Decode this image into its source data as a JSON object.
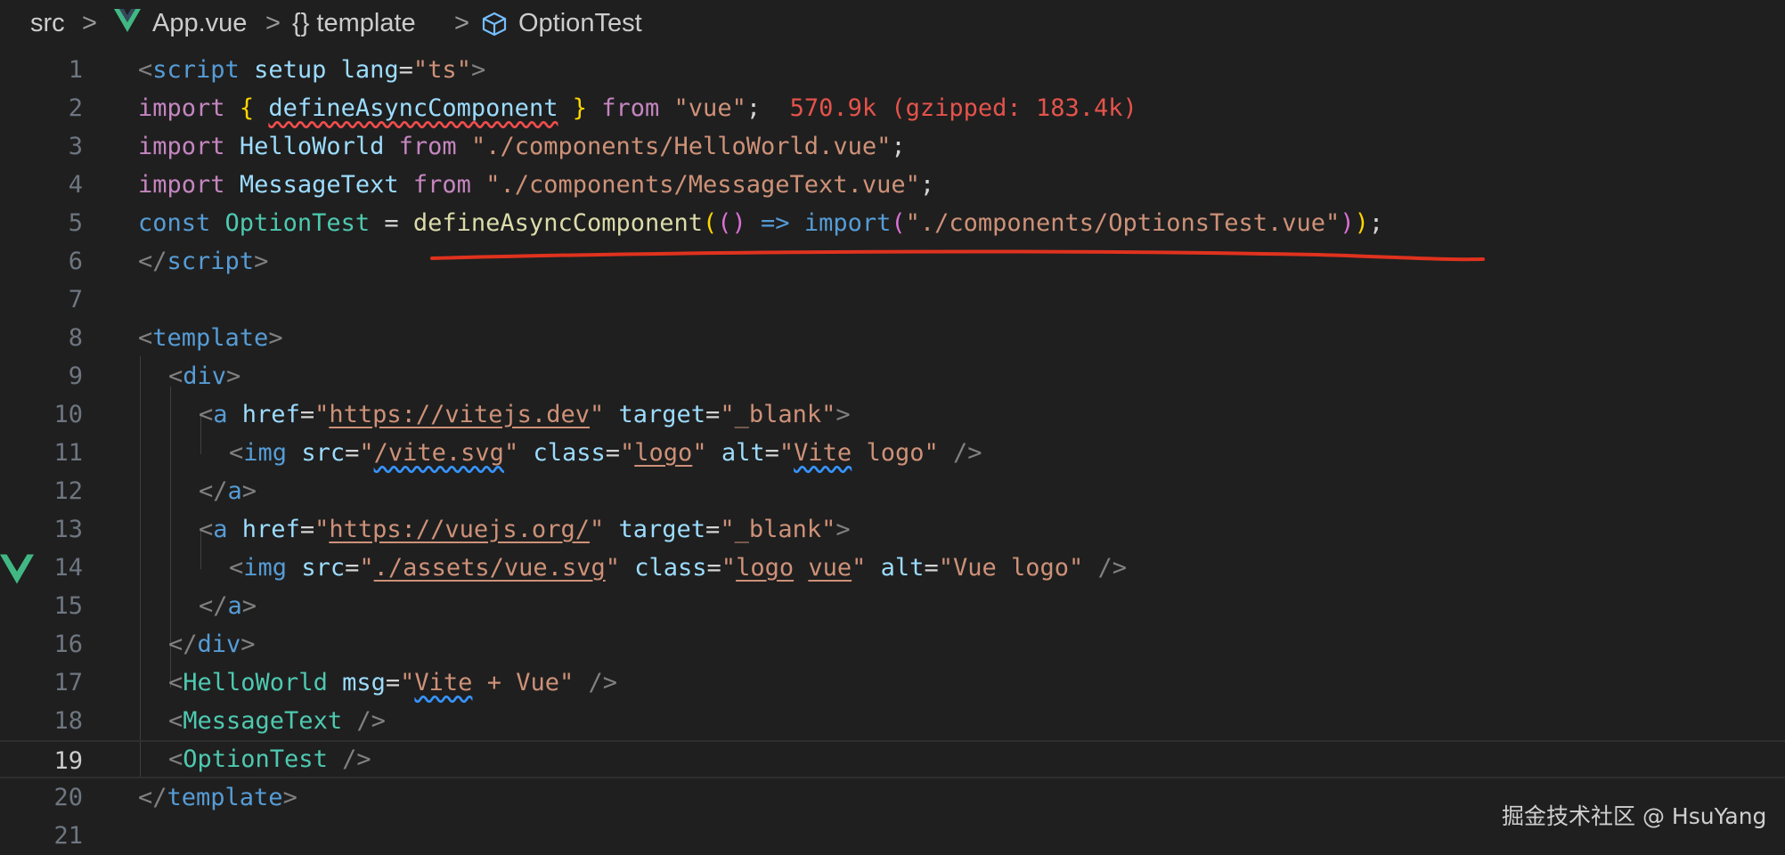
{
  "breadcrumb": {
    "items": [
      "src",
      "App.vue",
      "{} template",
      "OptionTest"
    ],
    "separator": ">"
  },
  "editor": {
    "current_line": 19,
    "line_numbers": [
      "1",
      "2",
      "3",
      "4",
      "5",
      "6",
      "7",
      "8",
      "9",
      "10",
      "11",
      "12",
      "13",
      "14",
      "15",
      "16",
      "17",
      "18",
      "19",
      "20",
      "21"
    ],
    "lines": {
      "l1": [
        "<",
        "script",
        " ",
        "setup",
        " ",
        "lang",
        "=",
        "\"ts\"",
        ">"
      ],
      "l2": [
        "import",
        " ",
        "{",
        " ",
        "defineAsyncComponent",
        " ",
        "}",
        " ",
        "from",
        " ",
        "\"vue\"",
        ";",
        "  570.9k (gzipped: 183.4k)"
      ],
      "l3": [
        "import",
        " ",
        "HelloWorld",
        " ",
        "from",
        " ",
        "\"./components/HelloWorld.vue\"",
        ";"
      ],
      "l4": [
        "import",
        " ",
        "MessageText",
        " ",
        "from",
        " ",
        "\"./components/MessageText.vue\"",
        ";"
      ],
      "l5": [
        "const",
        " ",
        "OptionTest",
        " = ",
        "defineAsyncComponent",
        "(",
        "()",
        " ",
        "=>",
        " ",
        "import",
        "(",
        "\"./components/OptionsTest.vue\"",
        ")",
        ")",
        ";"
      ],
      "l6": [
        "</",
        "script",
        ">"
      ],
      "l8": [
        "<",
        "template",
        ">"
      ],
      "l9": [
        "<",
        "div",
        ">"
      ],
      "l10": [
        "<",
        "a",
        " ",
        "href",
        "=",
        "\"",
        "https://vitejs.dev",
        "\"",
        " ",
        "target",
        "=",
        "\"_blank\"",
        ">"
      ],
      "l11": [
        "<",
        "img",
        " ",
        "src",
        "=",
        "\"",
        "/vite.svg",
        "\"",
        " ",
        "class",
        "=",
        "\"",
        "logo",
        "\"",
        " ",
        "alt",
        "=",
        "\"",
        "Vite",
        " logo\"",
        " />"
      ],
      "l12": [
        "</",
        "a",
        ">"
      ],
      "l13": [
        "<",
        "a",
        " ",
        "href",
        "=",
        "\"",
        "https://vuejs.org/",
        "\"",
        " ",
        "target",
        "=",
        "\"_blank\"",
        ">"
      ],
      "l14": [
        "<",
        "img",
        " ",
        "src",
        "=",
        "\"",
        "./assets/vue.svg",
        "\"",
        " ",
        "class",
        "=",
        "\"",
        "logo",
        " ",
        "vue",
        "\"",
        " ",
        "alt",
        "=",
        "\"Vue logo\"",
        " />"
      ],
      "l15": [
        "</",
        "a",
        ">"
      ],
      "l16": [
        "</",
        "div",
        ">"
      ],
      "l17": [
        "<",
        "HelloWorld",
        " ",
        "msg",
        "=",
        "\"",
        "Vite",
        " + Vue\"",
        " />"
      ],
      "l18": [
        "<",
        "MessageText",
        " />"
      ],
      "l19": [
        "<",
        "OptionTest",
        " />"
      ],
      "l20": [
        "</",
        "template",
        ">"
      ]
    }
  },
  "annotation": {
    "color": "#e0321e"
  },
  "watermark": "掘金技术社区 @ HsuYang",
  "icons": {
    "breadcrumb_file": "vue-logo-icon",
    "breadcrumb_symbol": "cube-icon",
    "gutter": "vue-logo-icon"
  },
  "colors": {
    "background": "#1f1f1f",
    "keyword": "#c586c0",
    "string": "#ce9178",
    "tag": "#569cd6",
    "component": "#4ec9b0"
  }
}
